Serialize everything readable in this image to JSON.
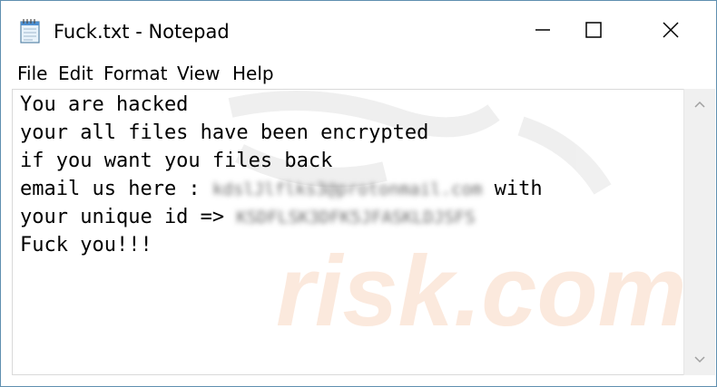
{
  "window": {
    "title": "Fuck.txt - Notepad",
    "icon": "notepad-icon",
    "controls": [
      "minimize-icon",
      "maximize-icon",
      "close-icon"
    ]
  },
  "menu": {
    "file": "File",
    "edit": "Edit",
    "format": "Format",
    "view": "View",
    "help": "Help"
  },
  "document": {
    "line1": "You are hacked",
    "line2": "your all files have been encrypted",
    "line3": "if you want you files back",
    "line4_prefix": "email us here :",
    "line4_email": "kdslJlflks3@protonmail.com",
    "line4_suffix": "with",
    "line5_prefix": "your unique id =>",
    "line5_id": "KSDFLSK3DFK5JFASKLDJSFS",
    "line6": "Fuck you!!!"
  },
  "watermark": {
    "text": "risk.com"
  },
  "colors": {
    "window_border": "#5f8fb0",
    "text": "#000000",
    "scrollbar": "#f0f0f0"
  }
}
